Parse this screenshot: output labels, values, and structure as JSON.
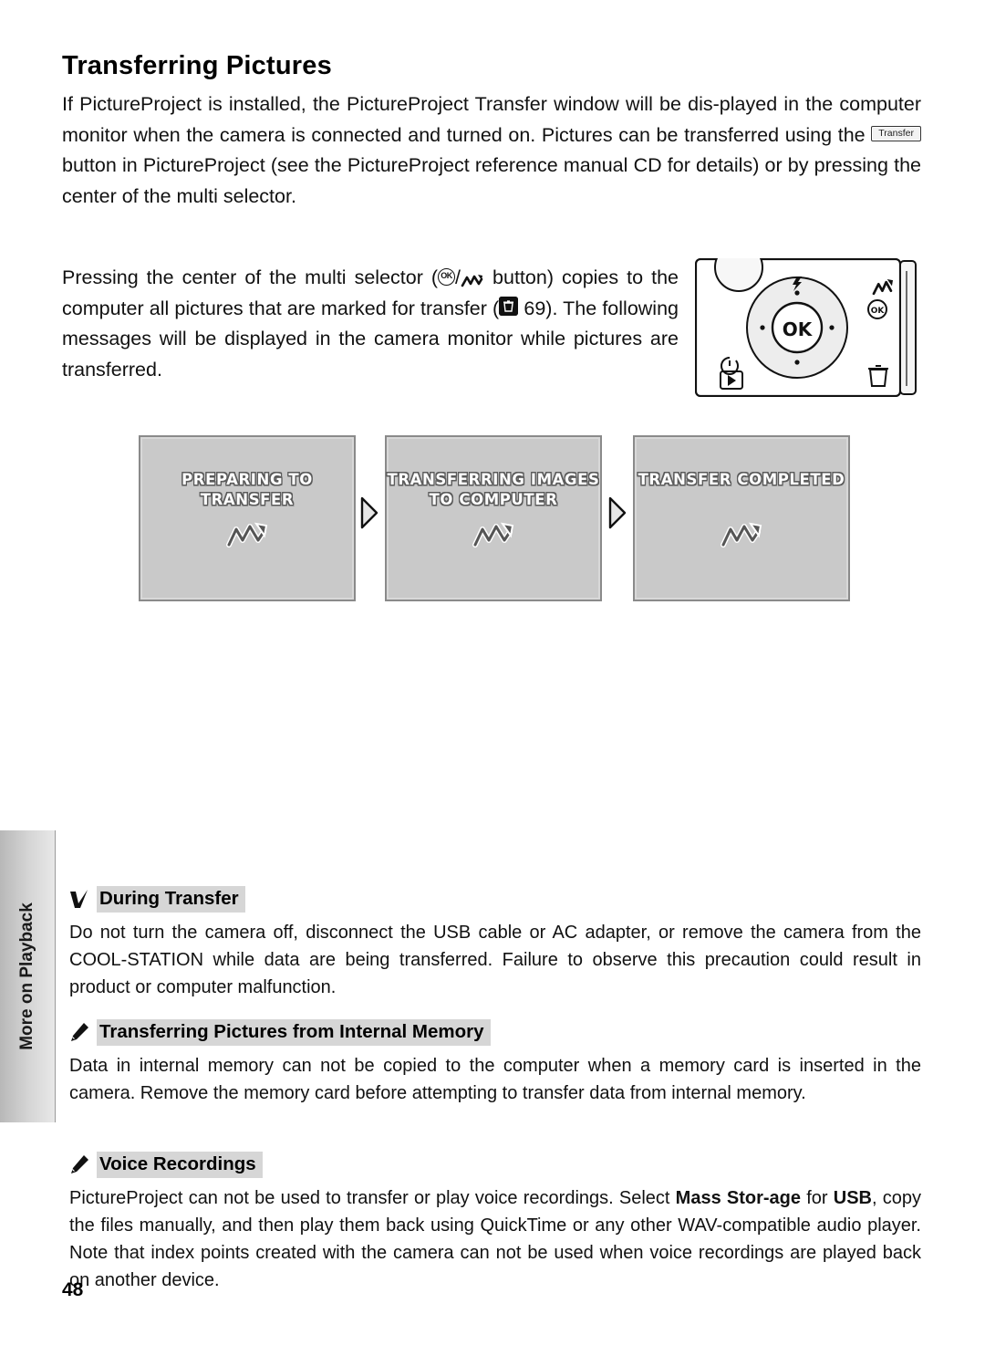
{
  "document": {
    "title": "Transferring Pictures",
    "page_number": "48",
    "side_tab_label": "More on Playback"
  },
  "paragraphs": {
    "p1_a": "If PictureProject is installed, the PictureProject Transfer window will be dis-played in the computer monitor when the camera is connected and turned on. Pictures can be transferred using the ",
    "p1_button_label": "Transfer",
    "p1_b": " button in PictureProject (see the PictureProject reference manual CD for details) or by pressing the center of the multi selector.",
    "p2_a": "Pressing the center of the multi selector (",
    "p2_ok": "OK",
    "p2_slash": "/",
    "p2_b": " button) copies to the computer all pictures that are marked for transfer (",
    "p2_page_ref": "69",
    "p2_c": "). The following messages will be displayed in the camera monitor while pictures are transferred."
  },
  "screens": [
    {
      "text": "PREPARING TO TRANSFER",
      "glyph": "transfer-icon"
    },
    {
      "text": "TRANSFERRING IMAGES\nTO COMPUTER",
      "glyph": "transfer-icon"
    },
    {
      "text": "TRANSFER COMPLETED",
      "glyph": "transfer-icon"
    }
  ],
  "screen_lines": {
    "s1": "PREPARING TO TRANSFER",
    "s2_l1": "TRANSFERRING IMAGES",
    "s2_l2": "TO COMPUTER",
    "s3": "TRANSFER COMPLETED"
  },
  "notes": [
    {
      "icon": "caution-icon",
      "title": "During Transfer",
      "body": "Do not turn the camera off, disconnect the USB cable or AC adapter, or remove the camera from the COOL-STATION while data are being transferred.  Failure to observe this precaution could result in product or computer malfunction."
    },
    {
      "icon": "pencil-icon",
      "title": "Transferring Pictures from Internal Memory",
      "body": "Data in internal memory can not be copied to the computer when a memory card is inserted in the camera.  Remove the memory card before attempting to transfer data from internal memory."
    },
    {
      "icon": "pencil-icon",
      "title": "Voice Recordings",
      "body_a": "PictureProject can not be used to transfer or play voice recordings.  Select ",
      "body_b": "Mass Stor-age",
      "body_c": " for ",
      "body_d": "USB",
      "body_e": ", copy the files manually, and then play them back using QuickTime or any other WAV-compatible audio player.  Note that index points created with the camera can not be used when voice recordings are played back on another device."
    }
  ],
  "camera_illustration": {
    "name": "camera-back-diagram",
    "buttons": [
      "mode-dial",
      "ok-button",
      "self-timer-button",
      "playback-button",
      "delete-button",
      "transfer-indicator"
    ]
  }
}
